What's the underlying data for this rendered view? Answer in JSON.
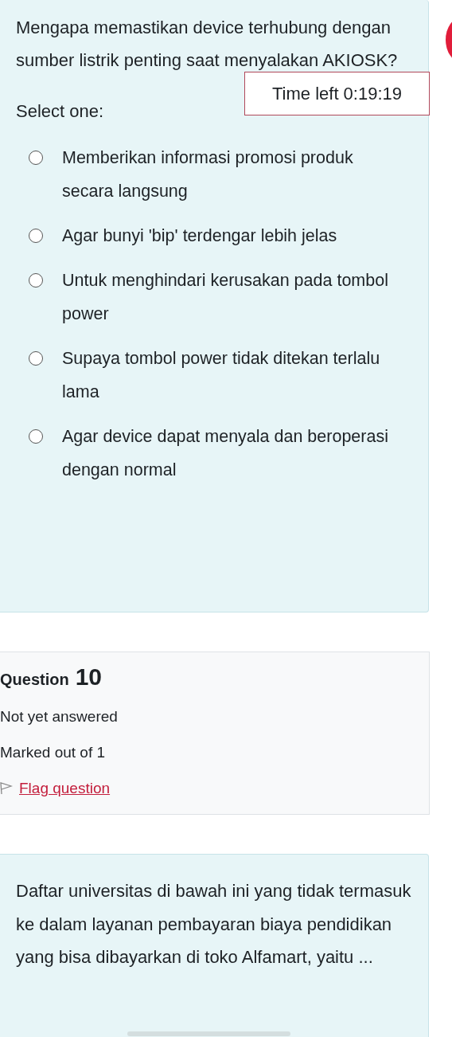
{
  "question_text": "Mengapa memastikan device terhubung dengan sumber listrik penting saat menyalakan AKIOSK?",
  "timer": "Time left 0:19:19",
  "prompt": "Select one:",
  "options": [
    {
      "label": "Memberikan informasi promosi produk secara langsung",
      "selected": false
    },
    {
      "label": "Agar bunyi 'bip' terdengar lebih jelas",
      "selected": false
    },
    {
      "label": "Untuk menghindari kerusakan pada tombol power",
      "selected": false
    },
    {
      "label": "Supaya tombol power tidak ditekan terlalu lama",
      "selected": false
    },
    {
      "label": "Agar device dapat menyala dan beroperasi dengan normal",
      "selected": false
    }
  ],
  "next_question": {
    "label": "Question",
    "number": "10",
    "status": "Not yet answered",
    "marks": "Marked out of 1",
    "flag_link": "Flag question"
  },
  "next_question_text": "Daftar universitas di bawah ini yang tidak termasuk ke dalam layanan pembayaran biaya pendidikan yang bisa dibayarkan di toko Alfamart, yaitu ..."
}
